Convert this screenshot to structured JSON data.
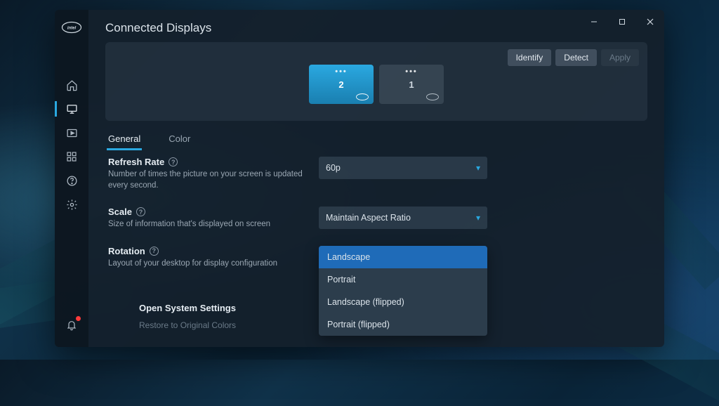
{
  "window": {
    "brand": "intel"
  },
  "sidebar": {
    "items": [
      {
        "name": "home",
        "icon": "home"
      },
      {
        "name": "display",
        "icon": "monitor",
        "active": true
      },
      {
        "name": "video",
        "icon": "video"
      },
      {
        "name": "apps",
        "icon": "grid"
      },
      {
        "name": "help",
        "icon": "help"
      },
      {
        "name": "settings",
        "icon": "gear"
      }
    ]
  },
  "page": {
    "title": "Connected Displays",
    "actions": {
      "identify": "Identify",
      "detect": "Detect",
      "apply": "Apply"
    },
    "displays": [
      {
        "id": "2",
        "selected": true
      },
      {
        "id": "1",
        "selected": false
      }
    ],
    "tabs": [
      {
        "key": "general",
        "label": "General",
        "active": true
      },
      {
        "key": "color",
        "label": "Color",
        "active": false
      }
    ],
    "settings": {
      "refresh": {
        "label": "Refresh Rate",
        "desc": "Number of times the picture on your screen is updated every second.",
        "value": "60p"
      },
      "scale": {
        "label": "Scale",
        "desc": "Size of information that's displayed on screen",
        "value": "Maintain Aspect Ratio"
      },
      "rotation": {
        "label": "Rotation",
        "desc": "Layout of your desktop for display configuration",
        "options": [
          "Landscape",
          "Portrait",
          "Landscape (flipped)",
          "Portrait (flipped)"
        ],
        "selected": "Landscape"
      }
    },
    "footer": {
      "open_settings": "Open System Settings",
      "restore": "Restore to Original Colors"
    }
  }
}
